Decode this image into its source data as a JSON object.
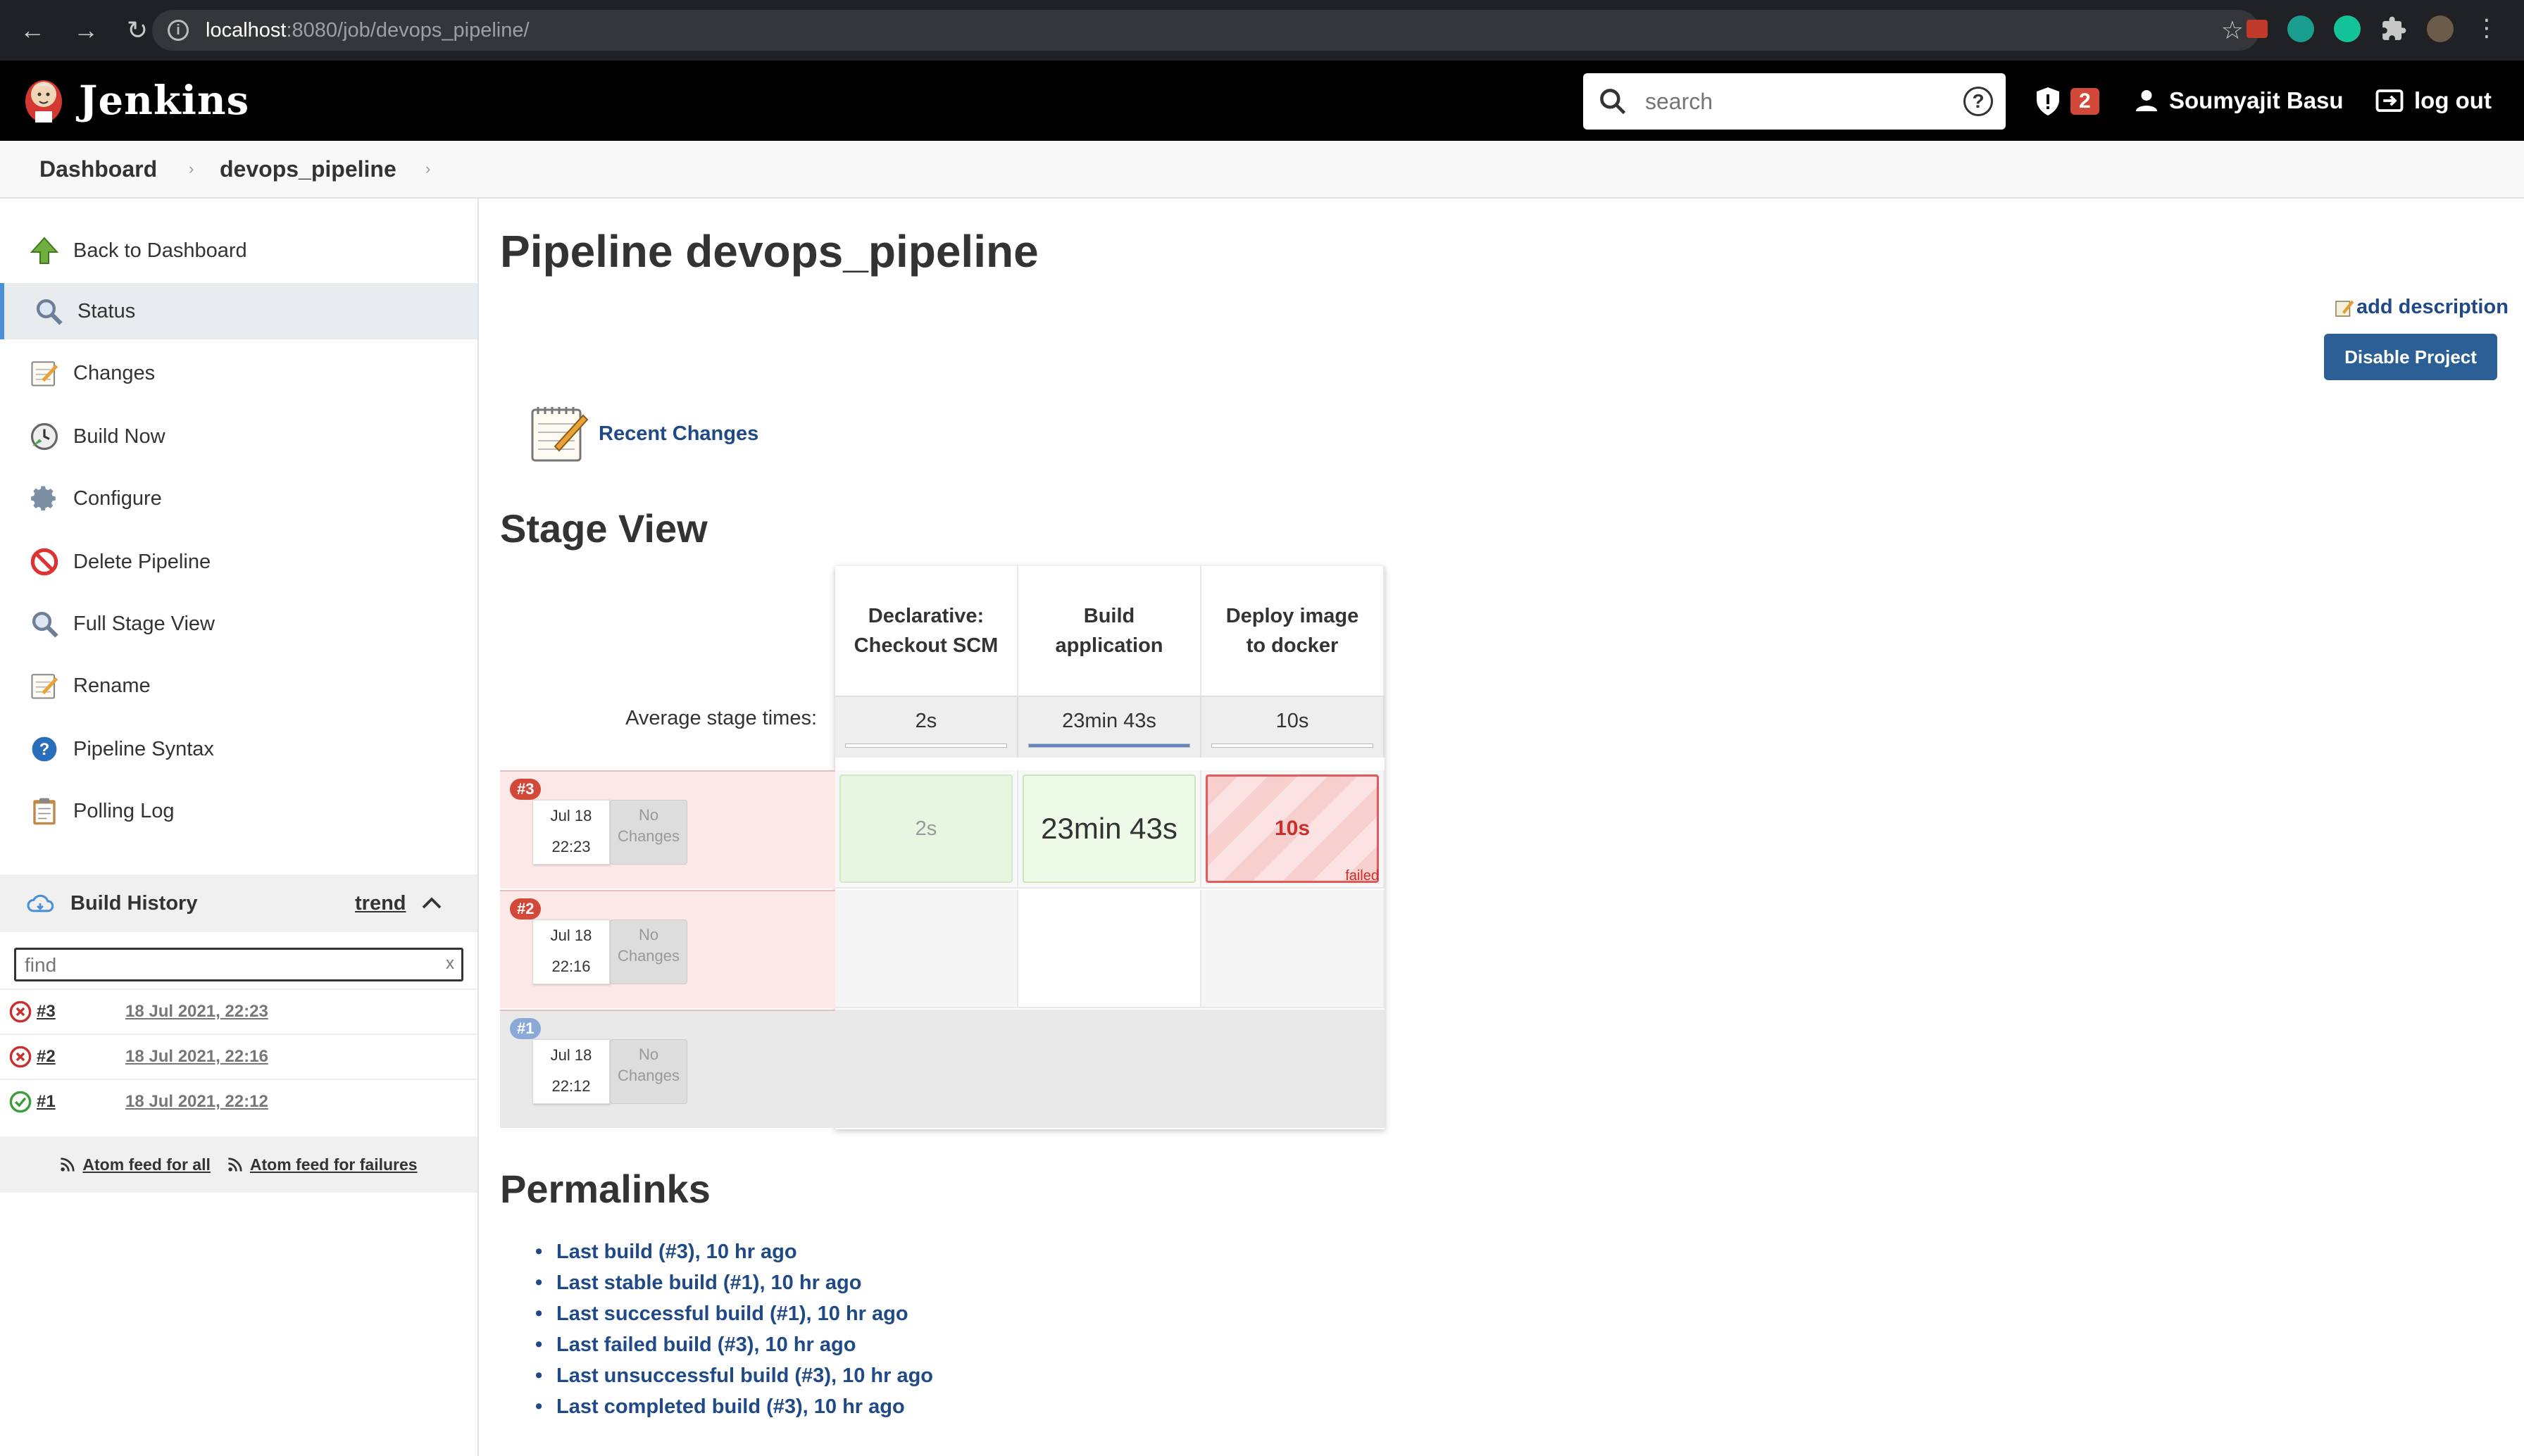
{
  "browser": {
    "url_host": "localhost",
    "url_rest": ":8080/job/devops_pipeline/",
    "back": "←",
    "forward": "→",
    "reload": "↻",
    "star": "☆"
  },
  "header": {
    "brand": "Jenkins",
    "search_placeholder": "search",
    "help": "?",
    "security_count": "2",
    "user_name": "Soumyajit Basu",
    "logout_label": "log out"
  },
  "breadcrumb": {
    "items": [
      "Dashboard",
      "devops_pipeline"
    ],
    "separator": "›"
  },
  "sidebar": {
    "tasks": [
      {
        "label": "Back to Dashboard",
        "icon": "up-arrow-icon"
      },
      {
        "label": "Status",
        "icon": "search-icon"
      },
      {
        "label": "Changes",
        "icon": "notepad-icon"
      },
      {
        "label": "Build Now",
        "icon": "clock-icon"
      },
      {
        "label": "Configure",
        "icon": "gear-icon"
      },
      {
        "label": "Delete Pipeline",
        "icon": "no-entry-icon"
      },
      {
        "label": "Full Stage View",
        "icon": "search-icon"
      },
      {
        "label": "Rename",
        "icon": "notepad-icon"
      },
      {
        "label": "Pipeline Syntax",
        "icon": "help-icon"
      },
      {
        "label": "Polling Log",
        "icon": "clipboard-icon"
      }
    ],
    "build_history": {
      "title": "Build History",
      "trend": "trend",
      "find_placeholder": "find",
      "clear": "x",
      "builds": [
        {
          "num": "#3",
          "date": "18 Jul 2021, 22:23",
          "status": "failed"
        },
        {
          "num": "#2",
          "date": "18 Jul 2021, 22:16",
          "status": "failed"
        },
        {
          "num": "#1",
          "date": "18 Jul 2021, 22:12",
          "status": "success"
        }
      ],
      "feed_all": "Atom feed for all",
      "feed_failures": "Atom feed for failures"
    }
  },
  "main": {
    "title": "Pipeline devops_pipeline",
    "add_description": "add description",
    "disable_button": "Disable Project",
    "recent_changes": "Recent Changes",
    "stage_view_title": "Stage View",
    "stages": [
      {
        "name": "Declarative: Checkout SCM",
        "avg": "2s",
        "avg_fraction": 0
      },
      {
        "name": "Build application",
        "avg": "23min 43s",
        "avg_fraction": 1
      },
      {
        "name": "Deploy image to docker",
        "avg": "10s",
        "avg_fraction": 0
      }
    ],
    "avg_label": "Average stage times:",
    "builds": [
      {
        "num": "#3",
        "date": "Jul 18",
        "time": "22:23",
        "changes": "No Changes",
        "badge_color": "#d24939",
        "row_bg": "#fde8e8",
        "cells": [
          {
            "text": "2s",
            "state": "success-faded"
          },
          {
            "text": "23min 43s",
            "state": "success"
          },
          {
            "text": "10s",
            "state": "failed",
            "tag": "failed"
          }
        ]
      },
      {
        "num": "#2",
        "date": "Jul 18",
        "time": "22:16",
        "changes": "No Changes",
        "badge_color": "#d24939",
        "row_bg": "#fde8e8",
        "cells": [
          {
            "text": "",
            "state": "empty"
          },
          {
            "text": "",
            "state": "empty-white"
          },
          {
            "text": "",
            "state": "empty"
          }
        ]
      },
      {
        "num": "#1",
        "date": "Jul 18",
        "time": "22:12",
        "changes": "No Changes",
        "badge_color": "#8aa9d6",
        "row_bg": "#e9e9e9",
        "cells": [
          {
            "text": "",
            "state": "empty-grey"
          },
          {
            "text": "",
            "state": "empty-grey"
          },
          {
            "text": "",
            "state": "empty-grey"
          }
        ]
      }
    ],
    "permalinks_title": "Permalinks",
    "permalinks": [
      "Last build (#3), 10 hr ago",
      "Last stable build (#1), 10 hr ago",
      "Last successful build (#1), 10 hr ago",
      "Last failed build (#3), 10 hr ago",
      "Last unsuccessful build (#3), 10 hr ago",
      "Last completed build (#3), 10 hr ago"
    ]
  },
  "colors": {
    "accent_link": "#204a87",
    "failed": "#d24939",
    "success_cell": "#eafbea",
    "button": "#2c5f96"
  }
}
